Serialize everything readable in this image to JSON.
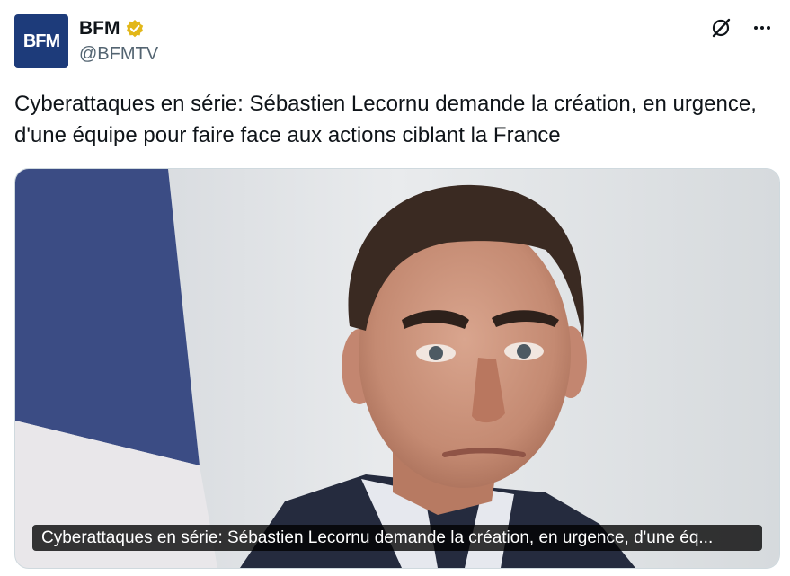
{
  "author": {
    "avatar_text": "BFM",
    "name": "BFM",
    "handle": "@BFMTV",
    "verified_icon": "gold-verified-badge-icon"
  },
  "actions": {
    "grok_icon": "grok-icon",
    "more_icon": "more-dots-icon",
    "more_label": "···"
  },
  "tweet": {
    "text": "Cyberattaques en série: Sébastien Lecornu demande la création, en urgence, d'une équipe pour faire face aux actions ciblant la France"
  },
  "media": {
    "caption": "Cyberattaques en série: Sébastien Lecornu demande la création, en urgence, d'une éq..."
  },
  "colors": {
    "avatar_bg": "#1d3b7a",
    "verified": "#e2b719",
    "text": "#0f1419",
    "secondary": "#536471"
  }
}
